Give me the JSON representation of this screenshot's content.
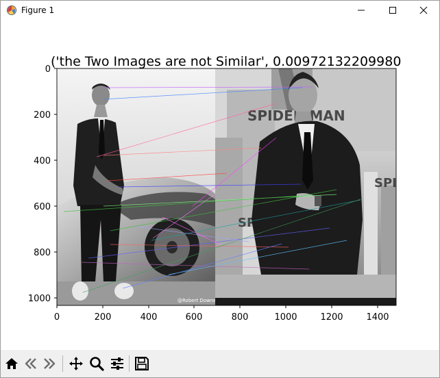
{
  "window": {
    "title": "Figure 1",
    "controls": [
      "minimize",
      "maximize",
      "close"
    ]
  },
  "figure": {
    "title": "('the Two Images are not Similar', 0.00972132209980",
    "x_ticks": [
      "0",
      "200",
      "400",
      "600",
      "800",
      "1000",
      "1200",
      "1400"
    ],
    "y_ticks": [
      "0",
      "200",
      "400",
      "600",
      "800",
      "1000"
    ],
    "image_watermark": "@Robert Downey Jr",
    "image_poster_text": "SPIDER-MAN"
  },
  "toolbar": {
    "buttons": [
      "home-icon",
      "back-icon",
      "forward-icon",
      "pan-icon",
      "zoom-icon",
      "configure-icon",
      "save-icon"
    ]
  },
  "colors": {
    "toolbar_bg": "#f0f0f0",
    "window_border": "#9a9a9a"
  }
}
